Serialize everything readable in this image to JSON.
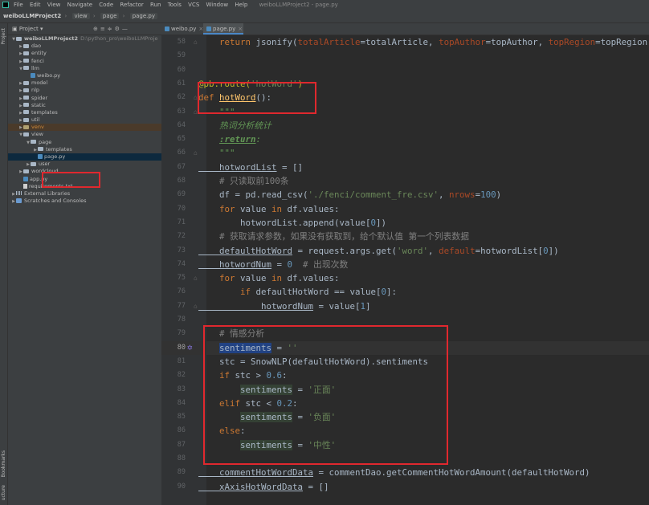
{
  "menubar": {
    "items": [
      "File",
      "Edit",
      "View",
      "Navigate",
      "Code",
      "Refactor",
      "Run",
      "Tools",
      "VCS",
      "Window",
      "Help"
    ],
    "window_title": "weiboLLMProject2 - page.py"
  },
  "navbar": {
    "project": "weiboLLMProject2",
    "crumbs": [
      "view",
      "page",
      "page.py"
    ]
  },
  "side_labels": {
    "project": "Project",
    "bookmarks": "Bookmarks",
    "structure": "ucture"
  },
  "project_panel": {
    "title": "Project",
    "tree": [
      {
        "label": "weiboLLMProject2",
        "path": "D:\\python_pro\\weiboLLMProje",
        "indent": 0,
        "expanded": true,
        "kind": "folder",
        "bold": true
      },
      {
        "label": "dao",
        "indent": 1,
        "expanded": false,
        "kind": "folder"
      },
      {
        "label": "entity",
        "indent": 1,
        "expanded": false,
        "kind": "folder"
      },
      {
        "label": "fenci",
        "indent": 1,
        "expanded": false,
        "kind": "folder"
      },
      {
        "label": "llm",
        "indent": 1,
        "expanded": true,
        "kind": "folder"
      },
      {
        "label": "weibo.py",
        "indent": 2,
        "kind": "py"
      },
      {
        "label": "model",
        "indent": 1,
        "expanded": false,
        "kind": "folder"
      },
      {
        "label": "nlp",
        "indent": 1,
        "expanded": false,
        "kind": "folder"
      },
      {
        "label": "spider",
        "indent": 1,
        "expanded": false,
        "kind": "folder"
      },
      {
        "label": "static",
        "indent": 1,
        "expanded": false,
        "kind": "folder"
      },
      {
        "label": "templates",
        "indent": 1,
        "expanded": false,
        "kind": "folder"
      },
      {
        "label": "util",
        "indent": 1,
        "expanded": false,
        "kind": "folder"
      },
      {
        "label": "venv",
        "indent": 1,
        "expanded": false,
        "kind": "venv"
      },
      {
        "label": "view",
        "indent": 1,
        "expanded": true,
        "kind": "folder"
      },
      {
        "label": "page",
        "indent": 2,
        "expanded": true,
        "kind": "folder"
      },
      {
        "label": "templates",
        "indent": 3,
        "expanded": false,
        "kind": "folder"
      },
      {
        "label": "page.py",
        "indent": 3,
        "kind": "py",
        "selected": true
      },
      {
        "label": "user",
        "indent": 2,
        "expanded": false,
        "kind": "folder"
      },
      {
        "label": "wordcloud",
        "indent": 1,
        "expanded": false,
        "kind": "folder"
      },
      {
        "label": "app.py",
        "indent": 1,
        "kind": "py"
      },
      {
        "label": "requirements.txt",
        "indent": 1,
        "kind": "txt"
      },
      {
        "label": "External Libraries",
        "indent": 0,
        "expanded": false,
        "kind": "lib"
      },
      {
        "label": "Scratches and Consoles",
        "indent": 0,
        "expanded": false,
        "kind": "scratch"
      }
    ]
  },
  "editor": {
    "tabs": [
      {
        "label": "weibo.py",
        "active": false
      },
      {
        "label": "page.py",
        "active": true
      }
    ],
    "current_line": 80,
    "lines": [
      {
        "n": 58,
        "segs": [
          [
            "k",
            "    return "
          ],
          [
            "t",
            "jsonify("
          ],
          [
            "p",
            "totalArticle"
          ],
          [
            "t",
            "=totalArticle, "
          ],
          [
            "p",
            "topAuthor"
          ],
          [
            "t",
            "=topAuthor, "
          ],
          [
            "p",
            "topRegion"
          ],
          [
            "t",
            "=topRegion,"
          ]
        ]
      },
      {
        "n": 59,
        "segs": []
      },
      {
        "n": 60,
        "segs": []
      },
      {
        "n": 61,
        "segs": [
          [
            "dec",
            "@pb.route("
          ],
          [
            "s",
            "'hotWord'"
          ],
          [
            "dec",
            ")"
          ]
        ]
      },
      {
        "n": 62,
        "segs": [
          [
            "k",
            "def "
          ],
          [
            "fn",
            "hotWord"
          ],
          [
            "t",
            "():"
          ]
        ]
      },
      {
        "n": 63,
        "segs": [
          [
            "d",
            "    \"\"\""
          ]
        ]
      },
      {
        "n": 64,
        "segs": [
          [
            "d",
            "    热词分析统计"
          ]
        ]
      },
      {
        "n": 65,
        "segs": [
          [
            "d",
            "    "
          ],
          [
            "dt",
            ":return"
          ],
          [
            "d",
            ":"
          ]
        ]
      },
      {
        "n": 66,
        "segs": [
          [
            "d",
            "    \"\"\""
          ]
        ]
      },
      {
        "n": 67,
        "segs": [
          [
            "u",
            "    hotwordList"
          ],
          [
            "t",
            " = []"
          ]
        ]
      },
      {
        "n": 68,
        "segs": [
          [
            "c",
            "    # 只读取前100条"
          ]
        ]
      },
      {
        "n": 69,
        "segs": [
          [
            "t",
            "    df = pd.read_csv("
          ],
          [
            "s",
            "'./fenci/comment_fre.csv'"
          ],
          [
            "t",
            ", "
          ],
          [
            "p",
            "nrows"
          ],
          [
            "t",
            "="
          ],
          [
            "n",
            "100"
          ],
          [
            "t",
            ")"
          ]
        ]
      },
      {
        "n": 70,
        "segs": [
          [
            "k",
            "    for "
          ],
          [
            "t",
            "value "
          ],
          [
            "k",
            "in "
          ],
          [
            "t",
            "df.values:"
          ]
        ]
      },
      {
        "n": 71,
        "segs": [
          [
            "t",
            "        hotwordList.append(value["
          ],
          [
            "n",
            "0"
          ],
          [
            "t",
            "])"
          ]
        ]
      },
      {
        "n": 72,
        "segs": [
          [
            "c",
            "    # 获取请求参数，如果没有获取到，给个默认值 第一个列表数据"
          ]
        ]
      },
      {
        "n": 73,
        "segs": [
          [
            "u",
            "    defaultHotWord"
          ],
          [
            "t",
            " = request.args.get("
          ],
          [
            "s",
            "'word'"
          ],
          [
            "t",
            ", "
          ],
          [
            "p",
            "default"
          ],
          [
            "t",
            "=hotwordList["
          ],
          [
            "n",
            "0"
          ],
          [
            "t",
            "])"
          ]
        ]
      },
      {
        "n": 74,
        "segs": [
          [
            "u",
            "    hotwordNum"
          ],
          [
            "t",
            " = "
          ],
          [
            "n",
            "0"
          ],
          [
            "c",
            "  # 出现次数"
          ]
        ]
      },
      {
        "n": 75,
        "segs": [
          [
            "k",
            "    for "
          ],
          [
            "t",
            "value "
          ],
          [
            "k",
            "in "
          ],
          [
            "t",
            "df.values:"
          ]
        ]
      },
      {
        "n": 76,
        "segs": [
          [
            "k",
            "        if "
          ],
          [
            "t",
            "defaultHotWord == value["
          ],
          [
            "n",
            "0"
          ],
          [
            "t",
            "]:"
          ]
        ]
      },
      {
        "n": 77,
        "segs": [
          [
            "u",
            "            hotwordNum"
          ],
          [
            "t",
            " = value["
          ],
          [
            "n",
            "1"
          ],
          [
            "t",
            "]"
          ]
        ]
      },
      {
        "n": 78,
        "segs": []
      },
      {
        "n": 79,
        "segs": [
          [
            "c",
            "    # 情感分析"
          ]
        ]
      },
      {
        "n": 80,
        "segs": [
          [
            "t",
            "    "
          ],
          [
            "hl",
            "sentiments"
          ],
          [
            "t",
            " = "
          ],
          [
            "s",
            "''"
          ]
        ]
      },
      {
        "n": 81,
        "segs": [
          [
            "t",
            "    stc = SnowNLP(defaultHotWord).sentiments"
          ]
        ]
      },
      {
        "n": 82,
        "segs": [
          [
            "k",
            "    if "
          ],
          [
            "t",
            "stc > "
          ],
          [
            "n",
            "0.6"
          ],
          [
            "t",
            ":"
          ]
        ]
      },
      {
        "n": 83,
        "segs": [
          [
            "t",
            "        "
          ],
          [
            "hl2",
            "sentiments"
          ],
          [
            "t",
            " = "
          ],
          [
            "s",
            "'正面'"
          ]
        ]
      },
      {
        "n": 84,
        "segs": [
          [
            "k",
            "    elif "
          ],
          [
            "t",
            "stc < "
          ],
          [
            "n",
            "0.2"
          ],
          [
            "t",
            ":"
          ]
        ]
      },
      {
        "n": 85,
        "segs": [
          [
            "t",
            "        "
          ],
          [
            "hl2",
            "sentiments"
          ],
          [
            "t",
            " = "
          ],
          [
            "s",
            "'负面'"
          ]
        ]
      },
      {
        "n": 86,
        "segs": [
          [
            "k",
            "    else"
          ],
          [
            "t",
            ":"
          ]
        ]
      },
      {
        "n": 87,
        "segs": [
          [
            "t",
            "        "
          ],
          [
            "hl2",
            "sentiments"
          ],
          [
            "t",
            " = "
          ],
          [
            "s",
            "'中性'"
          ]
        ]
      },
      {
        "n": 88,
        "segs": []
      },
      {
        "n": 89,
        "segs": [
          [
            "u",
            "    commentHotWordData"
          ],
          [
            "t",
            " = commentDao.getCommentHotWordAmount(defaultHotWord)"
          ]
        ]
      },
      {
        "n": 90,
        "segs": [
          [
            "u",
            "    xAxisHotWordData"
          ],
          [
            "t",
            " = []"
          ]
        ]
      }
    ]
  }
}
